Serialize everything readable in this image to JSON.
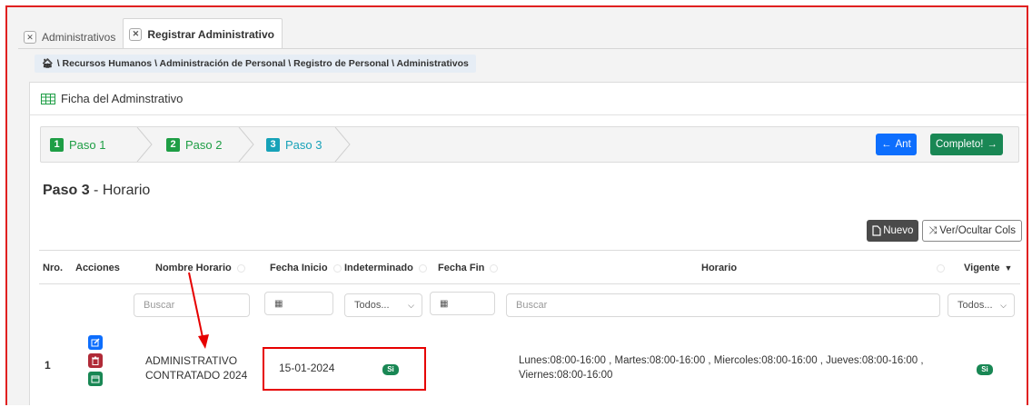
{
  "tabs": [
    {
      "label": "Administrativos",
      "active": false
    },
    {
      "label": "Registrar Administrativo",
      "active": true
    }
  ],
  "breadcrumb": "\\ Recursos Humanos \\ Administración de Personal \\ Registro de Personal \\ Administrativos",
  "panel": {
    "title": "Ficha del Adminstrativo"
  },
  "steps": [
    {
      "num": "1",
      "label": "Paso 1"
    },
    {
      "num": "2",
      "label": "Paso 2"
    },
    {
      "num": "3",
      "label": "Paso 3"
    }
  ],
  "nav": {
    "prev": "Ant",
    "complete": "Completo!"
  },
  "section": {
    "bold": "Paso 3",
    "rest": " - Horario"
  },
  "toolbar": {
    "nuevo": "Nuevo",
    "toggle_cols": "Ver/Ocultar Cols"
  },
  "table": {
    "headers": {
      "nro": "Nro.",
      "acciones": "Acciones",
      "nombre": "Nombre Horario",
      "fecha_inicio": "Fecha Inicio",
      "indeterminado": "Indeterminado",
      "fecha_fin": "Fecha Fin",
      "horario": "Horario",
      "vigente": "Vigente"
    },
    "filters": {
      "nombre_placeholder": "Buscar",
      "indeterminado_value": "Todos...",
      "horario_placeholder": "Buscar",
      "vigente_value": "Todos..."
    },
    "rows": [
      {
        "nro": "1",
        "nombre_line1": "ADMINISTRATIVO",
        "nombre_line2": "CONTRATADO 2024",
        "fecha_inicio": "15-01-2024",
        "indeterminado": "Si",
        "horario": "Lunes:08:00-16:00 , Martes:08:00-16:00 , Miercoles:08:00-16:00 , Jueves:08:00-16:00 ,",
        "horario_line2": "Viernes:08:00-16:00",
        "vigente": "Si"
      }
    ]
  },
  "colors": {
    "step_green": "#1e9e45",
    "step_teal": "#17a2b8",
    "btn_blue": "#0d6efd",
    "btn_green": "#198754",
    "btn_red": "#b02a37",
    "highlight_red": "#e60000"
  }
}
